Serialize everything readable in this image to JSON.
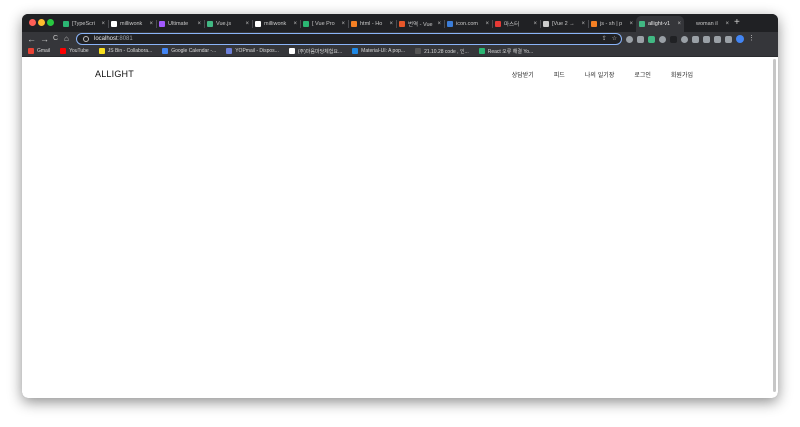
{
  "browser": {
    "tabs": [
      {
        "title": "[TypeScri",
        "favicon_color": "#2bb673",
        "active": false
      },
      {
        "title": "milliwonk",
        "favicon_color": "#ffffff",
        "active": false
      },
      {
        "title": "Ultimate ",
        "favicon_color": "#a259ff",
        "active": false
      },
      {
        "title": "Vue.js",
        "favicon_color": "#41b883",
        "active": false
      },
      {
        "title": "milliwonk",
        "favicon_color": "#ffffff",
        "active": false
      },
      {
        "title": "[ Vue Pro",
        "favicon_color": "#2bb673",
        "active": false
      },
      {
        "title": "html - Ho",
        "favicon_color": "#f48024",
        "active": false
      },
      {
        "title": "번역 - Vue",
        "favicon_color": "#e8572a",
        "active": false
      },
      {
        "title": "icon.com",
        "favicon_color": "#3b7dd8",
        "active": false
      },
      {
        "title": "마스터",
        "favicon_color": "#e53935",
        "active": false
      },
      {
        "title": "[Vue 2 →",
        "favicon_color": "#cccccc",
        "active": false
      },
      {
        "title": "js - sh | p",
        "favicon_color": "#f48024",
        "active": false
      },
      {
        "title": "allight-v1",
        "favicon_color": "#41b883",
        "active": true
      },
      {
        "title": "woman il",
        "favicon_color": "#202124",
        "active": false
      }
    ],
    "tab_close_glyph": "×",
    "new_tab_glyph": "+",
    "nav": {
      "back": "←",
      "forward": "→",
      "reload": "C",
      "home": "⌂"
    },
    "url_host": "localhost",
    "url_port": ":8081",
    "omnibox_icons": {
      "share": "⇪",
      "star": "☆"
    },
    "menu_glyph": "⋮"
  },
  "bookmarks": [
    {
      "label": "Gmail",
      "favicon_color": "#ea4335"
    },
    {
      "label": "YouTube",
      "favicon_color": "#ff0000"
    },
    {
      "label": "JS Bin - Collabora...",
      "favicon_color": "#f7df1e"
    },
    {
      "label": "Google Calendar -...",
      "favicon_color": "#4285f4"
    },
    {
      "label": "YOPmail - Dispos...",
      "favicon_color": "#6c7fd8"
    },
    {
      "label": "(주)마음마당체험요...",
      "favicon_color": "#ffffff"
    },
    {
      "label": "Material-UI: A pop...",
      "favicon_color": "#1e88e5"
    },
    {
      "label": "21.10.28 code , 인...",
      "favicon_color": "#555555"
    },
    {
      "label": "React 오류 해결 Yo...",
      "favicon_color": "#2bb673"
    }
  ],
  "site": {
    "logo": "ALLIGHT",
    "nav": [
      "상담받기",
      "피드",
      "나의 일기장",
      "로그인",
      "회원가입"
    ]
  }
}
